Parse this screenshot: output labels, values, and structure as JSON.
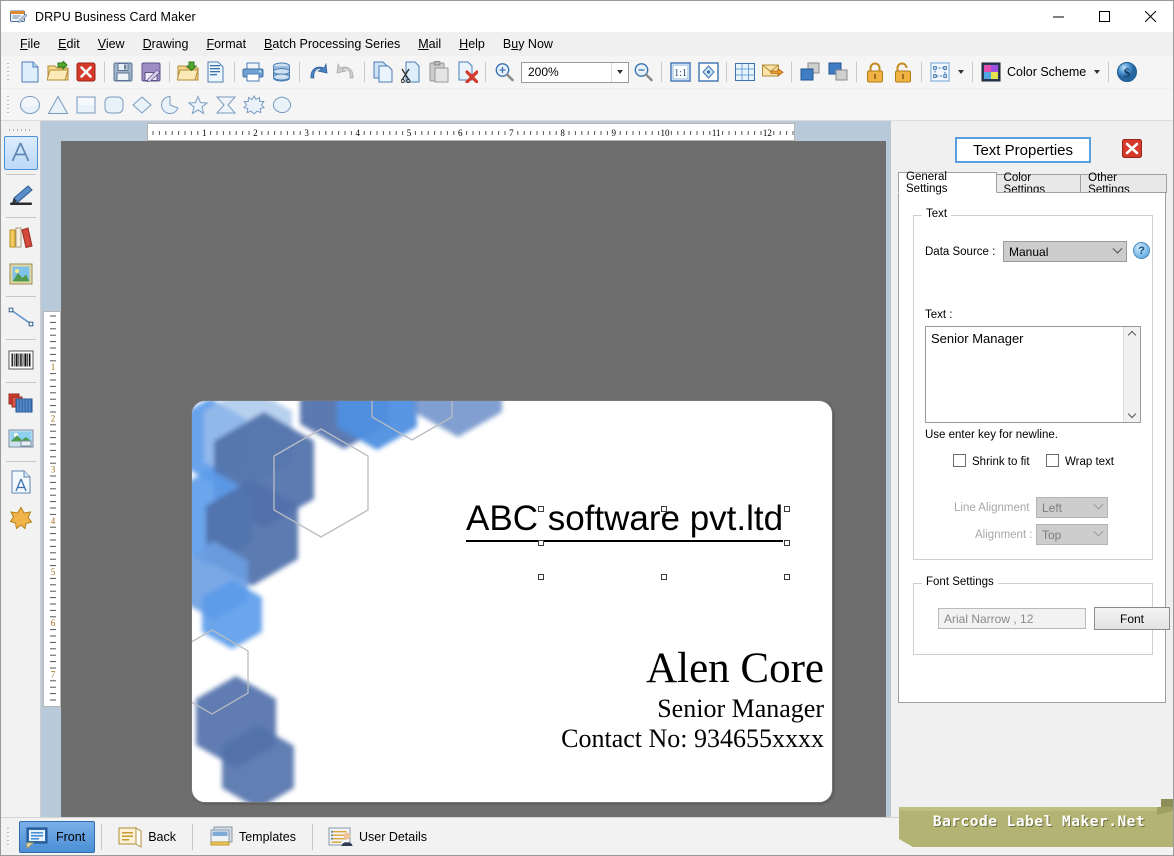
{
  "window": {
    "title": "DRPU Business Card Maker",
    "app_icon": "card-editor-icon",
    "minimize": "—",
    "maximize": "□",
    "close": "✕"
  },
  "menu": {
    "items": [
      {
        "label": "File",
        "accel_index": 0
      },
      {
        "label": "Edit",
        "accel_index": 0
      },
      {
        "label": "View",
        "accel_index": 0
      },
      {
        "label": "Drawing",
        "accel_index": 0
      },
      {
        "label": "Format",
        "accel_index": 0
      },
      {
        "label": "Batch Processing Series",
        "accel_index": 0
      },
      {
        "label": "Mail",
        "accel_index": 0
      },
      {
        "label": "Help",
        "accel_index": 0
      },
      {
        "label": "Buy Now",
        "accel_index": 2
      }
    ]
  },
  "toolbar_main": {
    "buttons": [
      {
        "name": "new-document-icon",
        "title": "New"
      },
      {
        "name": "open-folder-icon",
        "title": "Open"
      },
      {
        "name": "close-document-icon",
        "title": "Close"
      },
      {
        "name": "save-icon",
        "title": "Save"
      },
      {
        "name": "save-as-icon",
        "title": "Save As"
      },
      {
        "name": "import-icon",
        "title": "Import"
      },
      {
        "name": "report-icon",
        "title": "Report"
      },
      {
        "name": "print-icon",
        "title": "Print"
      },
      {
        "name": "database-icon",
        "title": "Database"
      },
      {
        "name": "undo-icon",
        "title": "Undo"
      },
      {
        "name": "redo-icon",
        "title": "Redo"
      },
      {
        "name": "copy-icon",
        "title": "Copy"
      },
      {
        "name": "cut-icon",
        "title": "Cut"
      },
      {
        "name": "paste-icon",
        "title": "Paste"
      },
      {
        "name": "delete-icon",
        "title": "Delete"
      },
      {
        "name": "zoom-in-icon",
        "title": "Zoom In"
      }
    ],
    "zoom_value": "200%",
    "buttons_right": [
      {
        "name": "zoom-out-icon",
        "title": "Zoom Out"
      },
      {
        "name": "zoom-actual-size-icon",
        "title": "1:1"
      },
      {
        "name": "zoom-fit-icon",
        "title": "Fit to Window"
      },
      {
        "name": "grid-icon",
        "title": "Grid"
      },
      {
        "name": "mail-send-icon",
        "title": "Send Mail"
      },
      {
        "name": "bring-to-front-icon",
        "title": "Bring to Front"
      },
      {
        "name": "send-to-back-icon",
        "title": "Send to Back"
      },
      {
        "name": "lock-icon",
        "title": "Lock"
      },
      {
        "name": "unlock-icon",
        "title": "Unlock"
      },
      {
        "name": "select-mode-icon",
        "title": "Selection Mode"
      }
    ],
    "color_scheme_label": "Color Scheme",
    "buy_icon": "dollar-icon"
  },
  "toolbar_shapes": {
    "shapes": [
      {
        "name": "ellipse-shape-icon"
      },
      {
        "name": "triangle-shape-icon"
      },
      {
        "name": "rectangle-shape-icon"
      },
      {
        "name": "rounded-rectangle-shape-icon"
      },
      {
        "name": "diamond-shape-icon"
      },
      {
        "name": "pie-shape-icon"
      },
      {
        "name": "star5-shape-icon"
      },
      {
        "name": "star4-shape-icon"
      },
      {
        "name": "burst-shape-icon"
      },
      {
        "name": "cloud-shape-icon"
      }
    ]
  },
  "left_rail": {
    "tools": [
      {
        "name": "text-tool",
        "icon": "text-A-icon",
        "selected": true
      },
      {
        "name": "pencil-tool",
        "icon": "pencil-icon",
        "selected": false
      },
      {
        "name": "library-tool",
        "icon": "books-icon",
        "selected": false
      },
      {
        "name": "picture-tool",
        "icon": "picture-icon",
        "selected": false
      },
      {
        "name": "line-tool",
        "icon": "line-icon",
        "selected": false
      },
      {
        "name": "barcode-tool",
        "icon": "barcode-icon",
        "selected": false
      },
      {
        "name": "layers-tool",
        "icon": "layers-icon",
        "selected": false
      },
      {
        "name": "image-tool",
        "icon": "photo-icon",
        "selected": false
      },
      {
        "name": "watermark-tool",
        "icon": "page-text-icon",
        "selected": false
      },
      {
        "name": "signature-tool",
        "icon": "star-shape-icon",
        "selected": false
      }
    ]
  },
  "rulers": {
    "horizontal_labels": [
      "1",
      "2",
      "3",
      "4",
      "5",
      "6",
      "7",
      "8",
      "9",
      "10",
      "11",
      "12"
    ],
    "vertical_labels": [
      "1",
      "2",
      "3",
      "4",
      "5",
      "6",
      "7"
    ],
    "unit": "inch"
  },
  "card": {
    "company": "ABC software pvt.ltd",
    "name": "Alen Core",
    "job_title": "Senior Manager",
    "contact": "Contact No: 934655xxxx",
    "art_colors": {
      "dark_blue": "#5171ab",
      "mid_blue": "#6b8ec9",
      "light_blue": "#5b9bea",
      "outline_gray": "#b9bcc2"
    },
    "selected_object": "job-title-text"
  },
  "properties_panel": {
    "title": "Text Properties",
    "close_icon": "close-red-icon",
    "tabs": [
      {
        "label": "General Settings",
        "active": true
      },
      {
        "label": "Color Settings",
        "active": false
      },
      {
        "label": "Other Settings",
        "active": false
      }
    ],
    "text_group": {
      "legend": "Text",
      "data_source_label": "Data Source :",
      "data_source_value": "Manual",
      "data_source_options": [
        "Manual"
      ],
      "help_icon": "question-mark-icon",
      "text_label": "Text :",
      "text_value": "Senior Manager",
      "hint": "Use enter key for newline.",
      "shrink_to_fit_label": "Shrink to fit",
      "shrink_to_fit_checked": false,
      "wrap_text_label": "Wrap text",
      "wrap_text_checked": false,
      "line_alignment_label": "Line Alignment",
      "line_alignment_value": "Left",
      "alignment_label": "Alignment :",
      "alignment_value": "Top"
    },
    "font_group": {
      "legend": "Font Settings",
      "font_value": "Arial Narrow , 12",
      "font_button": "Font"
    }
  },
  "bottom_bar": {
    "buttons": [
      {
        "label": "Front",
        "icon": "card-front-icon",
        "selected": true
      },
      {
        "label": "Back",
        "icon": "card-back-icon",
        "selected": false
      },
      {
        "label": "Templates",
        "icon": "templates-icon",
        "selected": false
      },
      {
        "label": "User Details",
        "icon": "user-details-icon",
        "selected": false
      }
    ],
    "ribbon_text": "Barcode Label Maker.Net",
    "ribbon_color": "#b3b474"
  },
  "colors": {
    "accent": "#4a8ed6",
    "canvas_backdrop": "#6e6e6e",
    "scroll_area": "#b8cada",
    "toolbar_bg": "#f5f5f5"
  }
}
